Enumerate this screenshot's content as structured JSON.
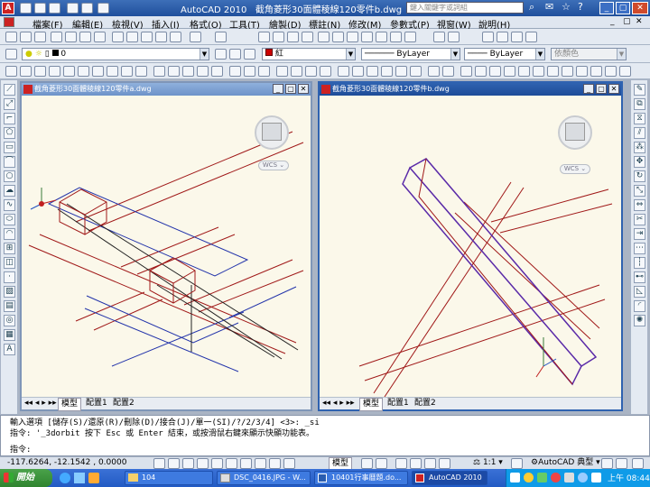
{
  "app": {
    "title": "AutoCAD 2010",
    "document": "截角菱形30面體稜線120零件b.dwg",
    "search_placeholder": "鍵入關鍵字或詞組"
  },
  "menu": [
    "檔案(F)",
    "編輯(E)",
    "檢視(V)",
    "插入(I)",
    "格式(O)",
    "工具(T)",
    "繪製(D)",
    "標註(N)",
    "修改(M)",
    "參數式(P)",
    "視窗(W)",
    "說明(H)"
  ],
  "properties_bar": {
    "layer": "0",
    "color": "紅",
    "linetype": "ByLayer",
    "lineweight": "ByLayer",
    "plotstyle": "依顏色"
  },
  "left_window": {
    "title": "截角菱形30面體稜線120零件a.dwg",
    "wcs": "WCS"
  },
  "right_window": {
    "title": "截角菱形30面體稜線120零件b.dwg",
    "wcs": "WCS"
  },
  "tabs": {
    "model": "模型",
    "layout1": "配置1",
    "layout2": "配置2"
  },
  "command": {
    "line1": "輸入選項 [儲存(S)/還原(R)/刪除(D)/接合(J)/單一(SI)/?/2/3/4] <3>: _si",
    "line2": "指令: '_3dorbit 按下 Esc 或 Enter 結束，或按滑鼠右鍵來顯示快顯功能表。",
    "prompt": "指令:"
  },
  "status": {
    "coords": "-117.6264, -12.1542 , 0.0000",
    "model": "模型",
    "scale": "1:1",
    "workspace": "AutoCAD 典型"
  },
  "taskbar": {
    "start": "開始",
    "items": [
      "104",
      "DSC_0416.JPG - W...",
      "10401行事曆題.do...",
      "AutoCAD 2010"
    ],
    "clock": "上午 08:44"
  },
  "colors": {
    "title_bar": "#1f4f9c",
    "drawing_bg": "#fbf8ea",
    "taskbar": "#225bc4"
  }
}
